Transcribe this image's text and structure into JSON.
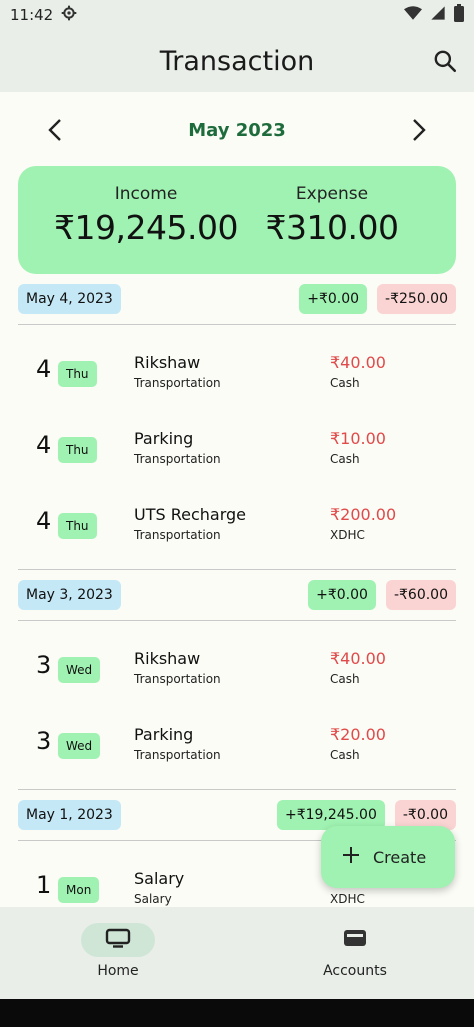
{
  "status_bar": {
    "time": "11:42"
  },
  "app_bar": {
    "title": "Transaction"
  },
  "month_nav": {
    "label": "May 2023"
  },
  "summary": {
    "income_label": "Income",
    "income_amount": "₹19,245.00",
    "expense_label": "Expense",
    "expense_amount": "₹310.00"
  },
  "groups": [
    {
      "date": "May 4, 2023",
      "income": "+₹0.00",
      "expense": "-₹250.00",
      "items": [
        {
          "day": "4",
          "weekday": "Thu",
          "title": "Rikshaw",
          "category": "Transportation",
          "amount": "₹40.00",
          "account": "Cash"
        },
        {
          "day": "4",
          "weekday": "Thu",
          "title": "Parking",
          "category": "Transportation",
          "amount": "₹10.00",
          "account": "Cash"
        },
        {
          "day": "4",
          "weekday": "Thu",
          "title": "UTS Recharge",
          "category": "Transportation",
          "amount": "₹200.00",
          "account": "XDHC"
        }
      ]
    },
    {
      "date": "May 3, 2023",
      "income": "+₹0.00",
      "expense": "-₹60.00",
      "items": [
        {
          "day": "3",
          "weekday": "Wed",
          "title": "Rikshaw",
          "category": "Transportation",
          "amount": "₹40.00",
          "account": "Cash"
        },
        {
          "day": "3",
          "weekday": "Wed",
          "title": "Parking",
          "category": "Transportation",
          "amount": "₹20.00",
          "account": "Cash"
        }
      ]
    },
    {
      "date": "May 1, 2023",
      "income": "+₹19,245.00",
      "expense": "-₹0.00",
      "items": [
        {
          "day": "1",
          "weekday": "Mon",
          "title": "Salary",
          "category": "Salary",
          "amount": "",
          "account": "XDHC"
        }
      ]
    }
  ],
  "fab": {
    "label": "Create"
  },
  "bottom_nav": {
    "home_label": "Home",
    "accounts_label": "Accounts"
  },
  "icons": {
    "settings": "gear-icon",
    "wifi": "wifi-icon",
    "signal": "signal-icon",
    "battery": "battery-icon",
    "search": "search-icon",
    "prev": "chevron-left-icon",
    "next": "chevron-right-icon",
    "add": "plus-icon",
    "home": "tv-icon",
    "accounts": "wallet-icon"
  },
  "colors": {
    "accent": "#9ff2b1",
    "expense_text": "#e04a4a",
    "month_text": "#1e6b3c",
    "date_chip": "#c5e8f6",
    "expense_chip": "#fad4d2"
  }
}
